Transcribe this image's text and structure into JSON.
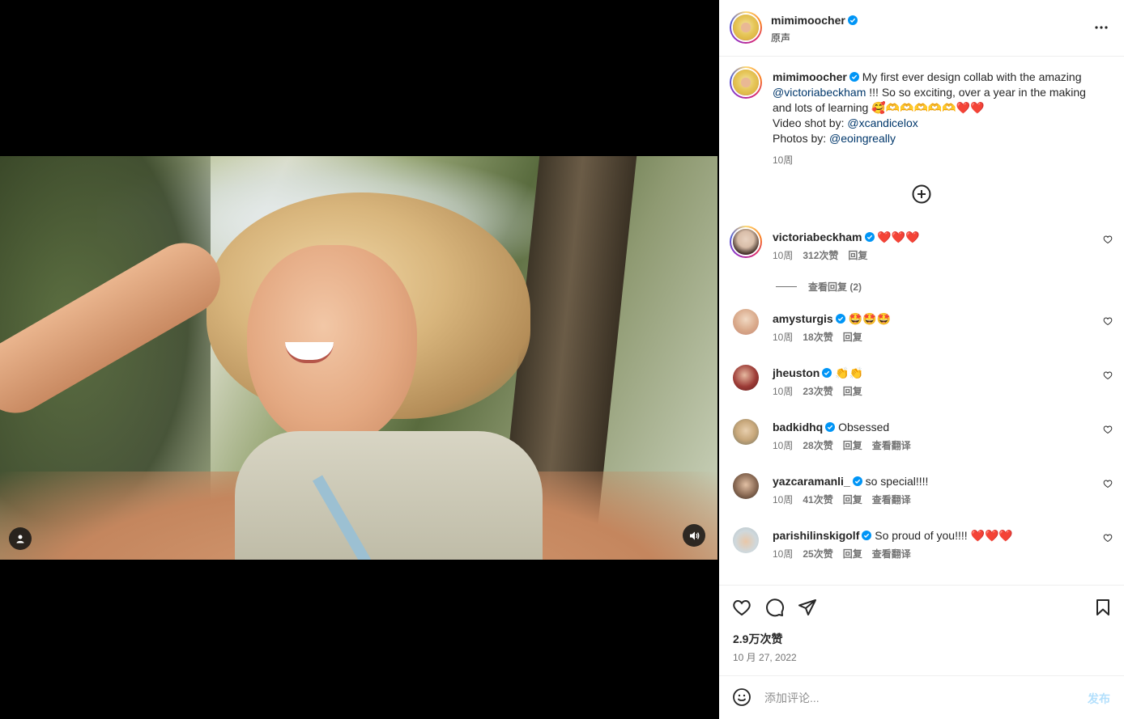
{
  "post": {
    "username": "mimimoocher",
    "audio": "原声",
    "caption_text": "My first ever design collab with the amazing",
    "mention_1": "@victoriabeckham",
    "caption_text_2": "!!! So so exciting, over a year in the making",
    "caption_text_3": "and lots of learning 🥰🫶🫶🫶🫶🫶❤️❤️",
    "video_by_label": "Video shot by:",
    "mention_2": "@xcandicelox",
    "photos_by_label": "Photos by:",
    "mention_3": "@eoingreally",
    "age": "10周",
    "likes": "2.9万次赞",
    "date": "10 月 27, 2022"
  },
  "comments": [
    {
      "user": "victoriabeckham",
      "text": "❤️❤️❤️",
      "age": "10周",
      "likes": "312次赞",
      "reply": "回复",
      "translate": ""
    },
    {
      "user": "amysturgis",
      "text": "🤩🤩🤩",
      "age": "10周",
      "likes": "18次赞",
      "reply": "回复",
      "translate": ""
    },
    {
      "user": "jheuston",
      "text": "👏👏",
      "age": "10周",
      "likes": "23次赞",
      "reply": "回复",
      "translate": ""
    },
    {
      "user": "badkidhq",
      "text": "Obsessed",
      "age": "10周",
      "likes": "28次赞",
      "reply": "回复",
      "translate": "查看翻译"
    },
    {
      "user": "yazcaramanli_",
      "text": "so special!!!!",
      "age": "10周",
      "likes": "41次赞",
      "reply": "回复",
      "translate": "查看翻译"
    },
    {
      "user": "parishilinskigolf",
      "text": "So proud of you!!!! ❤️❤️❤️",
      "age": "10周",
      "likes": "25次赞",
      "reply": "回复",
      "translate": "查看翻译"
    }
  ],
  "view_replies": "查看回复 (2)",
  "add_comment": {
    "placeholder": "添加评论...",
    "post_label": "发布"
  },
  "colors": {
    "link": "#00376b",
    "verified": "#0095f6",
    "post_disabled": "#b2dffc"
  },
  "icons": [
    "more-icon",
    "add-circle-icon",
    "heart-icon",
    "comment-icon",
    "share-icon",
    "bookmark-icon",
    "emoji-icon",
    "user-icon",
    "sound-icon",
    "verified-icon"
  ]
}
